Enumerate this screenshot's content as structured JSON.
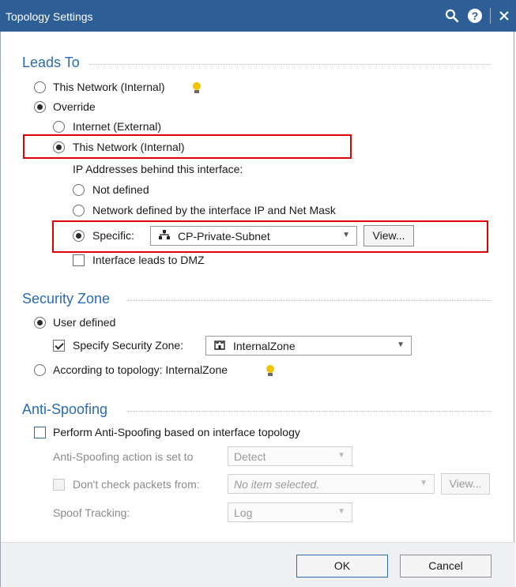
{
  "window": {
    "title": "Topology Settings"
  },
  "leads_to": {
    "title": "Leads To",
    "this_network": {
      "label": "This Network (Internal)",
      "selected": false
    },
    "override": {
      "label": "Override",
      "selected": true
    },
    "internet_external": {
      "label": "Internet (External)",
      "selected": false
    },
    "override_this_network": {
      "label": "This Network (Internal)",
      "selected": true
    },
    "ip_addresses_label": "IP Addresses behind this interface:",
    "not_defined": {
      "label": "Not defined",
      "selected": false
    },
    "network_defined": {
      "label": "Network defined by the interface IP and Net Mask",
      "selected": false
    },
    "specific": {
      "label": "Specific:",
      "selected": true,
      "value": "CP-Private-Subnet",
      "view_label": "View..."
    },
    "dmz": {
      "label": "Interface leads to DMZ",
      "checked": false
    }
  },
  "security_zone": {
    "title": "Security Zone",
    "user_defined": {
      "label": "User defined",
      "selected": true
    },
    "specify_zone": {
      "label": "Specify Security Zone:",
      "checked": true,
      "value": "InternalZone"
    },
    "according_topology": {
      "label": "According to topology: InternalZone",
      "selected": false
    }
  },
  "anti_spoofing": {
    "title": "Anti-Spoofing",
    "perform": {
      "label": "Perform Anti-Spoofing based on interface topology",
      "checked": false
    },
    "action_label": "Anti-Spoofing action is set to",
    "action_value": "Detect",
    "dont_check": {
      "label": "Don't check packets from:",
      "checked": false,
      "placeholder": "No item selected.",
      "view_label": "View..."
    },
    "spoof_tracking_label": "Spoof Tracking:",
    "spoof_tracking_value": "Log"
  },
  "footer": {
    "ok_label": "OK",
    "cancel_label": "Cancel"
  },
  "colors": {
    "titlebar": "#2d5f96",
    "section_title": "#2b6cb0",
    "highlight_box": "#e00000",
    "tip_bulb": "#f2c200"
  },
  "icons": {
    "search": "search-icon",
    "help": "help-icon",
    "close": "close-icon",
    "network": "network-icon",
    "zone": "zone-icon",
    "tip": "lightbulb-icon"
  }
}
